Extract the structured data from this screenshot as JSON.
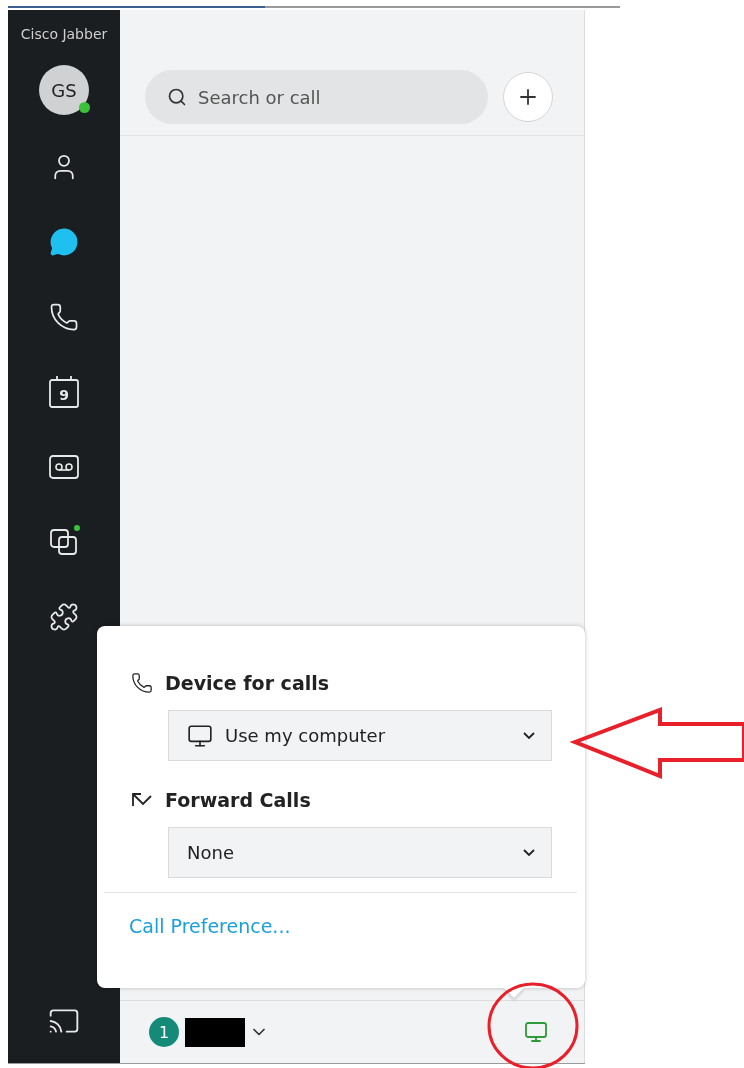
{
  "app_title": "Cisco Jabber",
  "avatar": {
    "initials": "GS",
    "online": true
  },
  "nav": [
    {
      "kind": "contacts",
      "selected": false,
      "notify": false
    },
    {
      "kind": "chats",
      "selected": true,
      "notify": false
    },
    {
      "kind": "calls",
      "selected": false,
      "notify": false
    },
    {
      "kind": "meetings",
      "selected": false,
      "notify": false,
      "day": "9"
    },
    {
      "kind": "voicemail",
      "selected": false,
      "notify": false
    },
    {
      "kind": "webex",
      "selected": false,
      "notify": true
    },
    {
      "kind": "extensions",
      "selected": false,
      "notify": false
    }
  ],
  "search": {
    "placeholder": "Search or call"
  },
  "popup": {
    "sections": [
      {
        "kind": "device",
        "title": "Device for calls",
        "value": "Use my computer"
      },
      {
        "kind": "forward",
        "title": "Forward Calls",
        "value": "None"
      }
    ],
    "link": "Call Preference..."
  },
  "footer": {
    "count": "1"
  }
}
